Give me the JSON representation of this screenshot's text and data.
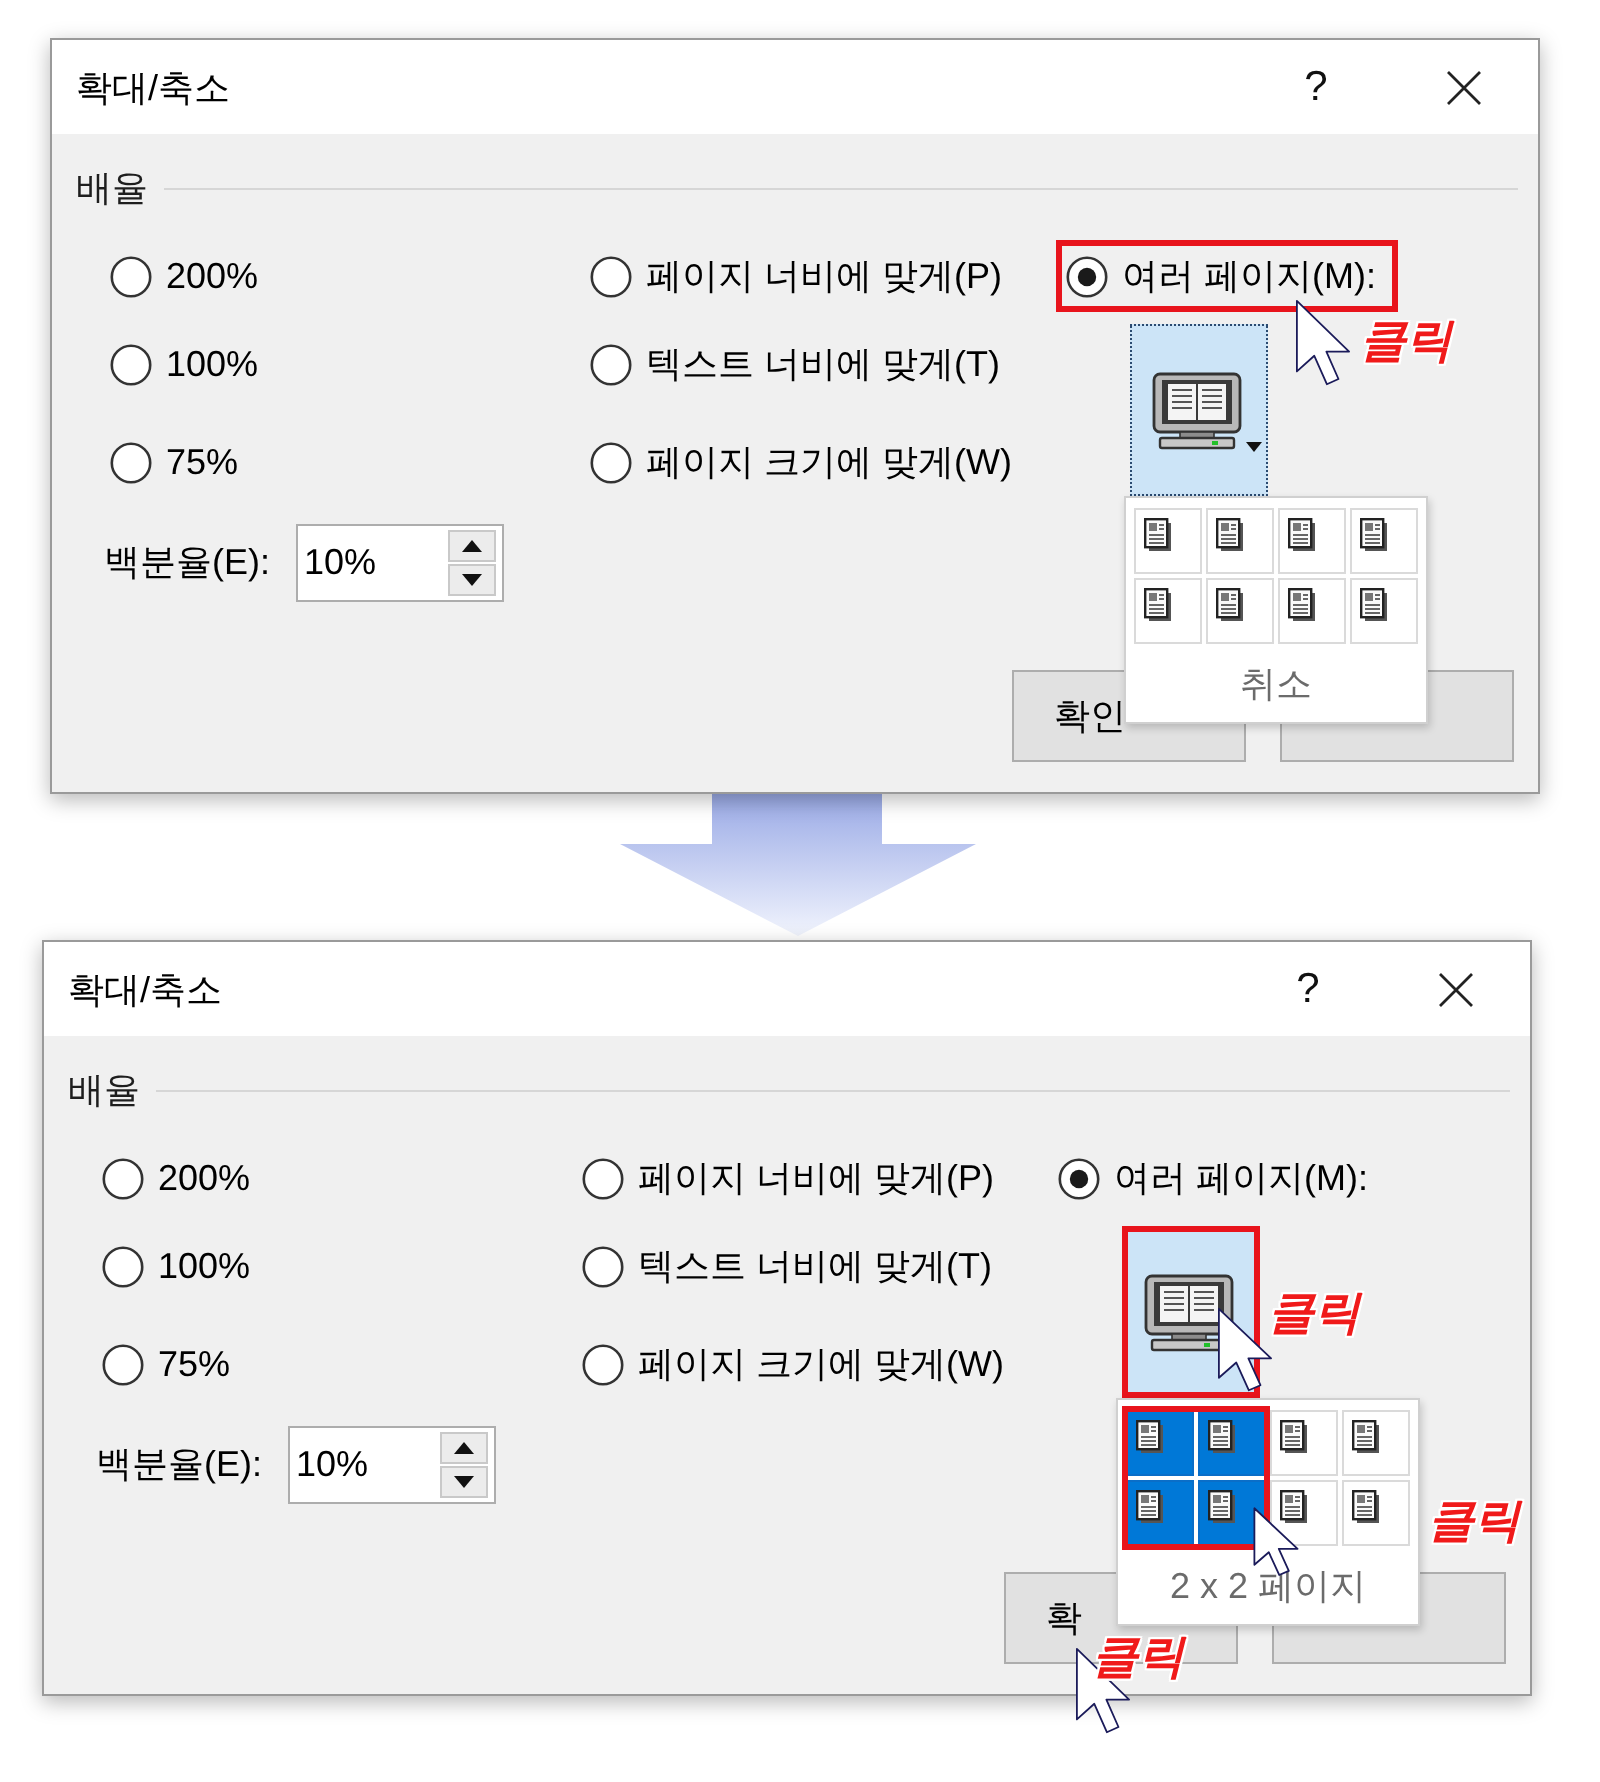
{
  "dialogs": [
    {
      "window": {
        "title": "확대/축소",
        "help": "?"
      },
      "group": {
        "label": "배율"
      },
      "zoom_levels": [
        {
          "label": "200%",
          "selected": false
        },
        {
          "label": "100%",
          "selected": false
        },
        {
          "label": "75%",
          "selected": false
        }
      ],
      "fit_options": [
        {
          "label": "페이지 너비에 맞게(P)",
          "selected": false
        },
        {
          "label": "텍스트 너비에 맞게(T)",
          "selected": false
        },
        {
          "label": "페이지 크기에 맞게(W)",
          "selected": false
        }
      ],
      "multiple_pages": {
        "label": "여러 페이지(M):",
        "selected": true,
        "highlighted": true,
        "pages_button": {
          "highlighted": false
        },
        "picker": {
          "highlighted": false,
          "rows": [
            {
              "cells": [
                {
                  "selected": false
                },
                {
                  "selected": false
                },
                {
                  "selected": false
                },
                {
                  "selected": false
                }
              ]
            },
            {
              "cells": [
                {
                  "selected": false
                },
                {
                  "selected": false
                },
                {
                  "selected": false
                },
                {
                  "selected": false
                }
              ]
            }
          ],
          "footer": "취소"
        }
      },
      "percent": {
        "label": "백분율(E):",
        "value": "10%"
      },
      "buttons": [
        {
          "kind": "ok",
          "label": "확인"
        },
        {
          "kind": "cancel"
        }
      ],
      "annotations": [
        {
          "kind": "option",
          "label": "클릭"
        }
      ]
    },
    {
      "window": {
        "title": "확대/축소",
        "help": "?"
      },
      "group": {
        "label": "배율"
      },
      "zoom_levels": [
        {
          "label": "200%",
          "selected": false
        },
        {
          "label": "100%",
          "selected": false
        },
        {
          "label": "75%",
          "selected": false
        }
      ],
      "fit_options": [
        {
          "label": "페이지 너비에 맞게(P)",
          "selected": false
        },
        {
          "label": "텍스트 너비에 맞게(T)",
          "selected": false
        },
        {
          "label": "페이지 크기에 맞게(W)",
          "selected": false
        }
      ],
      "multiple_pages": {
        "label": "여러 페이지(M):",
        "selected": true,
        "highlighted": false,
        "pages_button": {
          "highlighted": true
        },
        "picker": {
          "highlighted": true,
          "rows": [
            {
              "cells": [
                {
                  "selected": true
                },
                {
                  "selected": true
                },
                {
                  "selected": false
                },
                {
                  "selected": false
                }
              ]
            },
            {
              "cells": [
                {
                  "selected": true
                },
                {
                  "selected": true
                },
                {
                  "selected": false
                },
                {
                  "selected": false
                }
              ]
            }
          ],
          "footer": "2 x 2 페이지"
        }
      },
      "percent": {
        "label": "백분율(E):",
        "value": "10%"
      },
      "buttons": [
        {
          "kind": "ok",
          "label": "확"
        },
        {
          "kind": "cancel"
        }
      ],
      "annotations": [
        {
          "kind": "pages_button",
          "label": "클릭"
        },
        {
          "kind": "picker",
          "label": "클릭"
        },
        {
          "kind": "ok_button",
          "label": "클릭"
        }
      ]
    }
  ]
}
